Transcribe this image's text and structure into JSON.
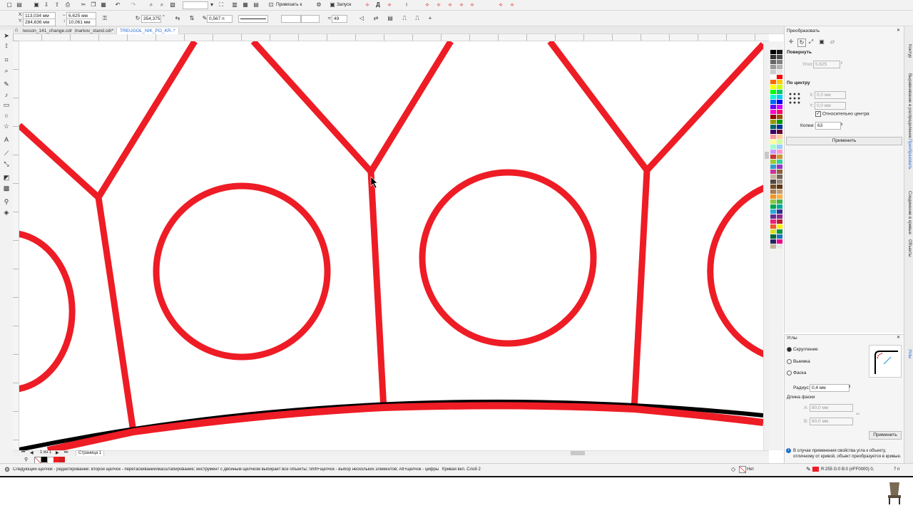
{
  "toolbar": {
    "snap_label": "Привязать к",
    "launch_label": "Запуск",
    "zoom_value": ""
  },
  "propbar": {
    "x": "113,034 мм",
    "y": "284,636 мм",
    "w": "6,625 мм",
    "h": "10,061 мм",
    "angle": "354,375",
    "outline_width": "0,567 п",
    "smoothing": "49"
  },
  "tabs": [
    {
      "label": "lesson_141_change.cdr"
    },
    {
      "label": "markov_stand.cdr*"
    },
    {
      "label": "TREUGOL_NIK_PO_KR..*"
    }
  ],
  "transform_panel": {
    "title": "Преобразовать",
    "rotate_title": "Повернуть",
    "angle_label": "Угол:",
    "angle_value": "5,625",
    "center_title": "По центру",
    "x_label": "X:",
    "x_value": "0,0 мм",
    "y_label": "Y:",
    "y_value": "0,0 мм",
    "relative_center": "Относительно центра",
    "copies_label": "Копии:",
    "copies_value": "63",
    "apply": "Применить"
  },
  "corners_panel": {
    "title": "Углы",
    "rounding": "Скругление",
    "notch": "Выемка",
    "chamfer": "Фаска",
    "radius_label": "Радиус:",
    "radius_value": "0,4 мм",
    "chamfer_length_label": "Длина фаски",
    "len_a_label": "A:",
    "len_a_value": "80,0 мм",
    "len_b_label": "B:",
    "len_b_value": "80,0 мм",
    "apply": "Применить",
    "info": "В случае применения свойства угла к объекту, отличному от кривой, объект преобразуется в кривые."
  },
  "side_tabs": [
    "Контур",
    "Выравнивание и распределение",
    "Преобразовать",
    "Соединение в кривые",
    "Объекты"
  ],
  "side_tabs2": [
    "Углы"
  ],
  "page_tab": "Страница 1",
  "status": {
    "hint": "Следующий щелчок - редактирование: второй щелчок - перетаскивание/масштабирование; инструмент с двойным щелчком выбирает все объекты; Shift+щелчок - выбор нескольких элементов; Alt+щелчок - цифры",
    "object": "Кривая вкл. Слой 2",
    "fill_none": "Нет",
    "outline_color": "R:255 G:0 B:0 (#FF0000)  0,",
    "outline_width": "7 п"
  },
  "colors": {
    "red": "#ee1c25",
    "canvas": "#ffffff",
    "chrome": "#f2f2f2"
  },
  "palette": [
    "#000000",
    "#1a1a1a",
    "#333333",
    "#4d4d4d",
    "#666666",
    "#808080",
    "#999999",
    "#b3b3b3",
    "#cccccc",
    "#e6e6e6",
    "#ffffff",
    "#ff0000",
    "#ff6600",
    "#ffcc00",
    "#ffff00",
    "#ccff00",
    "#00ff00",
    "#00cc66",
    "#00ffcc",
    "#00ccff",
    "#0066ff",
    "#0000ff",
    "#6600ff",
    "#cc00ff",
    "#ff00cc",
    "#ff0066",
    "#990000",
    "#994c00",
    "#999900",
    "#009900",
    "#006666",
    "#003399",
    "#330066",
    "#660033",
    "#ff9999",
    "#ffcc99",
    "#ffff99",
    "#ccff99",
    "#99ffcc",
    "#99ccff",
    "#cc99ff",
    "#ff99cc",
    "#cc3333",
    "#cc9933",
    "#99cc33",
    "#33cc99",
    "#3399cc",
    "#9933cc",
    "#cc3399",
    "#8c6239",
    "#c7b299",
    "#736357",
    "#534741",
    "#998675",
    "#754c24",
    "#603813",
    "#a67c52",
    "#c69c6d",
    "#f7941d",
    "#fbb040",
    "#8dc63f",
    "#39b54a",
    "#00a651",
    "#00a99d",
    "#27aae1",
    "#2e3192",
    "#662d91",
    "#92278f",
    "#ed1e79",
    "#be1e2d",
    "#f15a29",
    "#fff200",
    "#d7df23",
    "#009444",
    "#006838",
    "#1c75bc",
    "#262262",
    "#ec008c",
    "#c2b59b",
    "#e6e7e8"
  ]
}
